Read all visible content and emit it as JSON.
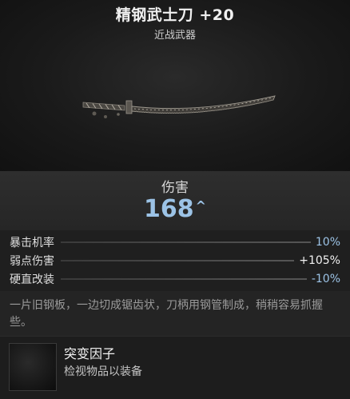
{
  "item": {
    "name": "精钢武士刀 +20",
    "category": "近战武器"
  },
  "damage": {
    "label": "伤害",
    "value": "168",
    "trend_icon": "chevron-up-icon",
    "color": "#9cc3e6"
  },
  "stats": [
    {
      "name": "暴击机率",
      "value": "10%",
      "style": "pos"
    },
    {
      "name": "弱点伤害",
      "value": "+105%",
      "style": "neutral"
    },
    {
      "name": "硬直改装",
      "value": "-10%",
      "style": "pos"
    }
  ],
  "description": "一片旧钢板，一边切成锯齿状，刀柄用钢管制成，稍稍容易抓握些。",
  "mutator": {
    "title": "突变因子",
    "subtitle": "检视物品以装备"
  }
}
